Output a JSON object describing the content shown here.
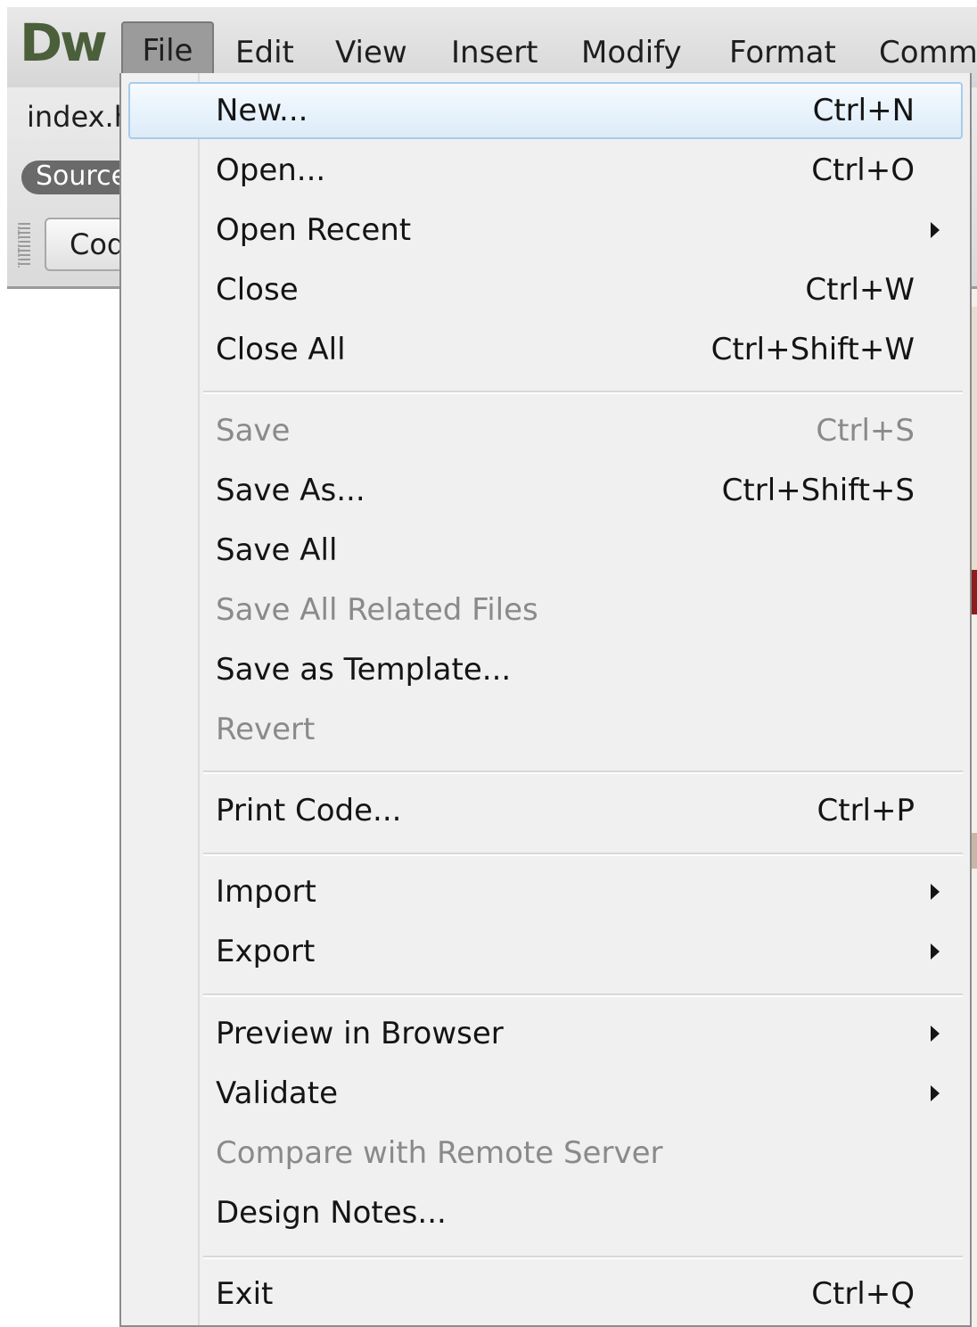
{
  "app": {
    "logo": "Dw",
    "menubar": [
      "File",
      "Edit",
      "View",
      "Insert",
      "Modify",
      "Format",
      "Comma"
    ],
    "doc_tab": "index.h",
    "source_pill": "Source",
    "code_button": "Cod"
  },
  "colors": {
    "menubar": "#dcdcdc",
    "active_menu": "#9b9b9b",
    "dropdown_bg": "#f0f0f0",
    "highlight": "#dcebf8",
    "disabled_text": "#8a8a8a"
  },
  "file_menu": {
    "items": [
      {
        "label": "New...",
        "shortcut": "Ctrl+N"
      },
      {
        "label": "Open...",
        "shortcut": "Ctrl+O"
      },
      {
        "label": "Open Recent",
        "shortcut": ""
      },
      {
        "label": "Close",
        "shortcut": "Ctrl+W"
      },
      {
        "label": "Close All",
        "shortcut": "Ctrl+Shift+W"
      },
      {
        "label": "Save",
        "shortcut": "Ctrl+S"
      },
      {
        "label": "Save As...",
        "shortcut": "Ctrl+Shift+S"
      },
      {
        "label": "Save All",
        "shortcut": ""
      },
      {
        "label": "Save All Related Files",
        "shortcut": ""
      },
      {
        "label": "Save as Template...",
        "shortcut": ""
      },
      {
        "label": "Revert",
        "shortcut": ""
      },
      {
        "label": "Print Code...",
        "shortcut": "Ctrl+P"
      },
      {
        "label": "Import",
        "shortcut": ""
      },
      {
        "label": "Export",
        "shortcut": ""
      },
      {
        "label": "Preview in Browser",
        "shortcut": ""
      },
      {
        "label": "Validate",
        "shortcut": ""
      },
      {
        "label": "Compare with Remote Server",
        "shortcut": ""
      },
      {
        "label": "Design Notes...",
        "shortcut": ""
      },
      {
        "label": "Exit",
        "shortcut": "Ctrl+Q"
      }
    ]
  }
}
